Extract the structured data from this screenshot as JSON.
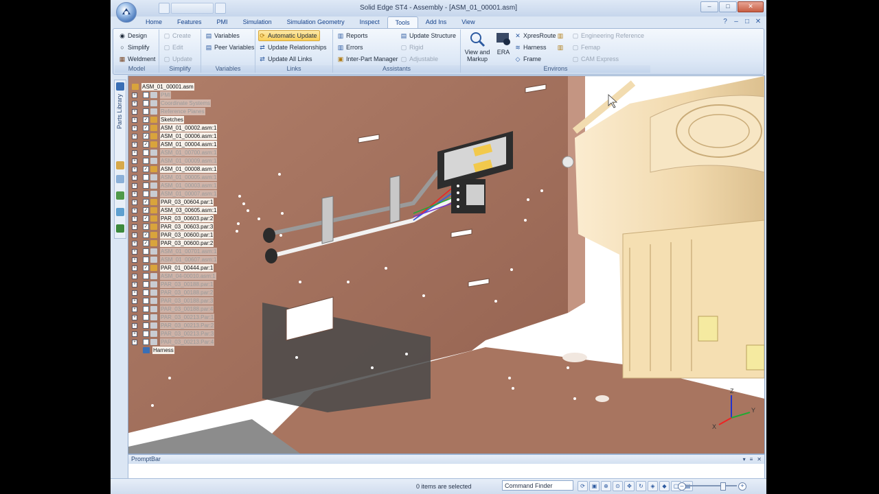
{
  "window": {
    "title": "Solid Edge ST4 - Assembly - [ASM_01_00001.asm]"
  },
  "tabs": [
    "Home",
    "Features",
    "PMI",
    "Simulation",
    "Simulation Geometry",
    "Inspect",
    "Tools",
    "Add Ins",
    "View"
  ],
  "active_tab": "Tools",
  "ribbon": {
    "model": {
      "label": "Model",
      "items": [
        "Design",
        "Simplify",
        "Weldment"
      ]
    },
    "simplify": {
      "label": "Simplify",
      "items": [
        "Create",
        "Edit",
        "Update"
      ]
    },
    "variables": {
      "label": "Variables",
      "items": [
        "Variables",
        "Peer Variables"
      ]
    },
    "links": {
      "label": "Links",
      "items": [
        "Automatic Update",
        "Update Relationships",
        "Update All Links"
      ]
    },
    "assistants": {
      "label": "Assistants",
      "items": [
        "Reports",
        "Errors",
        "Inter-Part Manager",
        "Update Structure",
        "Rigid",
        "Adjustable"
      ]
    },
    "environs": {
      "label": "Environs",
      "view_markup": "View and Markup",
      "era": "ERA",
      "items": [
        "XpresRoute",
        "Harness",
        "Frame"
      ],
      "right_items": [
        "Engineering Reference",
        "Femap",
        "CAM Express"
      ]
    }
  },
  "side_panel": {
    "parts_library": "Parts Library"
  },
  "tree": {
    "root": "ASM_01_00001.asm",
    "nodes": [
      {
        "label": "PMI",
        "checked": false,
        "on": false
      },
      {
        "label": "Coordinate Systems",
        "checked": false,
        "on": false
      },
      {
        "label": "Reference Planes",
        "checked": false,
        "on": false
      },
      {
        "label": "Sketches",
        "checked": true,
        "on": true
      },
      {
        "label": "ASM_01_00002.asm:1",
        "checked": true,
        "on": true
      },
      {
        "label": "ASM_01_00006.asm:1",
        "checked": true,
        "on": true
      },
      {
        "label": "ASM_01_00004.asm:1",
        "checked": true,
        "on": true
      },
      {
        "label": "ASM_01_00700.asm:1",
        "checked": false,
        "on": false
      },
      {
        "label": "ASM_01_00009.asm:1",
        "checked": false,
        "on": false
      },
      {
        "label": "ASM_01_00008.asm:1",
        "checked": true,
        "on": true
      },
      {
        "label": "ASM_01_00005.asm:1",
        "checked": false,
        "on": false
      },
      {
        "label": "ASM_01_00003.asm:1",
        "checked": false,
        "on": false
      },
      {
        "label": "ASM_01_00007.asm:1",
        "checked": false,
        "on": false
      },
      {
        "label": "PAR_03_00604.par:1",
        "checked": true,
        "on": true
      },
      {
        "label": "ASM_03_00605.asm:1",
        "checked": true,
        "on": true
      },
      {
        "label": "PAR_03_00603.par:2",
        "checked": true,
        "on": true
      },
      {
        "label": "PAR_03_00603.par:3",
        "checked": true,
        "on": true
      },
      {
        "label": "PAR_03_00600.par:1",
        "checked": true,
        "on": true
      },
      {
        "label": "PAR_03_00600.par:2",
        "checked": true,
        "on": true
      },
      {
        "label": "ASM_01_00701.asm:1",
        "checked": false,
        "on": false
      },
      {
        "label": "ASM_01_00607.asm:1",
        "checked": false,
        "on": false
      },
      {
        "label": "PAR_01_00444.par:1",
        "checked": true,
        "on": true
      },
      {
        "label": "ASM_04-00010.asm:1",
        "checked": false,
        "on": false
      },
      {
        "label": "PAR_03_00188.par:1",
        "checked": false,
        "on": false
      },
      {
        "label": "PAR_03_00188.par:2",
        "checked": false,
        "on": false
      },
      {
        "label": "PAR_03_00188.par:3",
        "checked": false,
        "on": false
      },
      {
        "label": "PAR_03_00188.par:4",
        "checked": false,
        "on": false
      },
      {
        "label": "PAR_03_00213.Par:1",
        "checked": false,
        "on": false
      },
      {
        "label": "PAR_03_00213.Par:2",
        "checked": false,
        "on": false
      },
      {
        "label": "PAR_03_00213.Par:3",
        "checked": false,
        "on": false
      },
      {
        "label": "PAR_03_00213.Par:4",
        "checked": false,
        "on": false
      }
    ],
    "harness": "Harness"
  },
  "promptbar": {
    "title": "PromptBar"
  },
  "status": {
    "selection": "0 items are selected",
    "command_finder": "Command Finder"
  },
  "axes": {
    "x": "X",
    "y": "Y",
    "z": "Z"
  },
  "colors": {
    "plate": "#a06a55",
    "engine": "#f3dfb8",
    "accent": "#15428b"
  }
}
